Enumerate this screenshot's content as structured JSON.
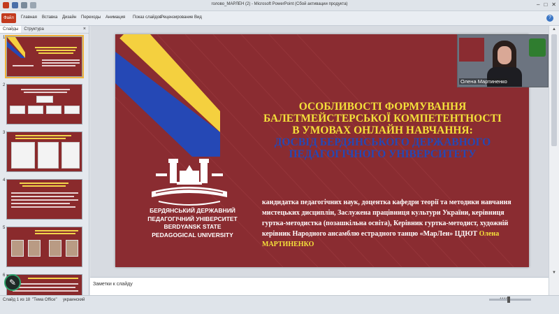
{
  "window": {
    "title": "голово_МАРЛЕН (2) - Microsoft PowerPoint (Сбой активации продукта)"
  },
  "ribbon": {
    "file_tab": "Файл",
    "tabs": [
      "Главная",
      "Вставка",
      "Дизайн",
      "Переходы",
      "Анимация",
      "Показ слайдов",
      "Рецензирование",
      "Вид"
    ]
  },
  "left_panel": {
    "tab_slides": "Слайды",
    "tab_outline": "Структура",
    "close_glyph": "×",
    "slide_numbers": [
      "1",
      "2",
      "3",
      "4",
      "5",
      "6"
    ]
  },
  "slide": {
    "heading_lines": [
      "ОСОБЛИВОСТІ ФОРМУВАННЯ",
      "БАЛЕТМЕЙСТЕРСЬКОЇ КОМПЕТЕНТНОСТІ",
      "В УМОВАХ ОНЛАЙН НАВЧАННЯ:"
    ],
    "heading_blue_lines": [
      "ДОСВІД БЕРДЯНСЬКОГО ДЕРЖАВНОГО",
      "ПЕДАГОГІЧНОГО УНІВЕРСИТЕТУ"
    ],
    "university_lines": [
      "БЕРДЯНСЬКИЙ ДЕРЖАВНИЙ",
      "ПЕДАГОГІЧНИЙ УНІВЕРСИТЕТ",
      "BERDYANSK STATE",
      "PEDAGOGICAL UNIVERSITY"
    ],
    "bio_text": "кандидатка педагогічних наук, доцентка кафедри теорії та методики навчання мистецьких дисциплін, Заслужена працівниця культури України, керівниця гуртка-методистка (позашкільна освіта), Керівник гуртка-методист, художній керівник Народного ансамблю естрадного танцю «МарЛен» ЦДЮТ ",
    "bio_name": "Олена МАРТИНЕНКО",
    "colors": {
      "background": "#8a2c31",
      "yellow": "#f4d03f",
      "blue": "#2548b5"
    }
  },
  "video": {
    "participant_name": "Олена Мартиненко"
  },
  "notes": {
    "placeholder": "Заметки к слайду"
  },
  "status": {
    "slide_counter": "Слайд 1 из 18",
    "theme": "\"Тема Office\"",
    "language": "украинский",
    "zoom": "111%"
  }
}
